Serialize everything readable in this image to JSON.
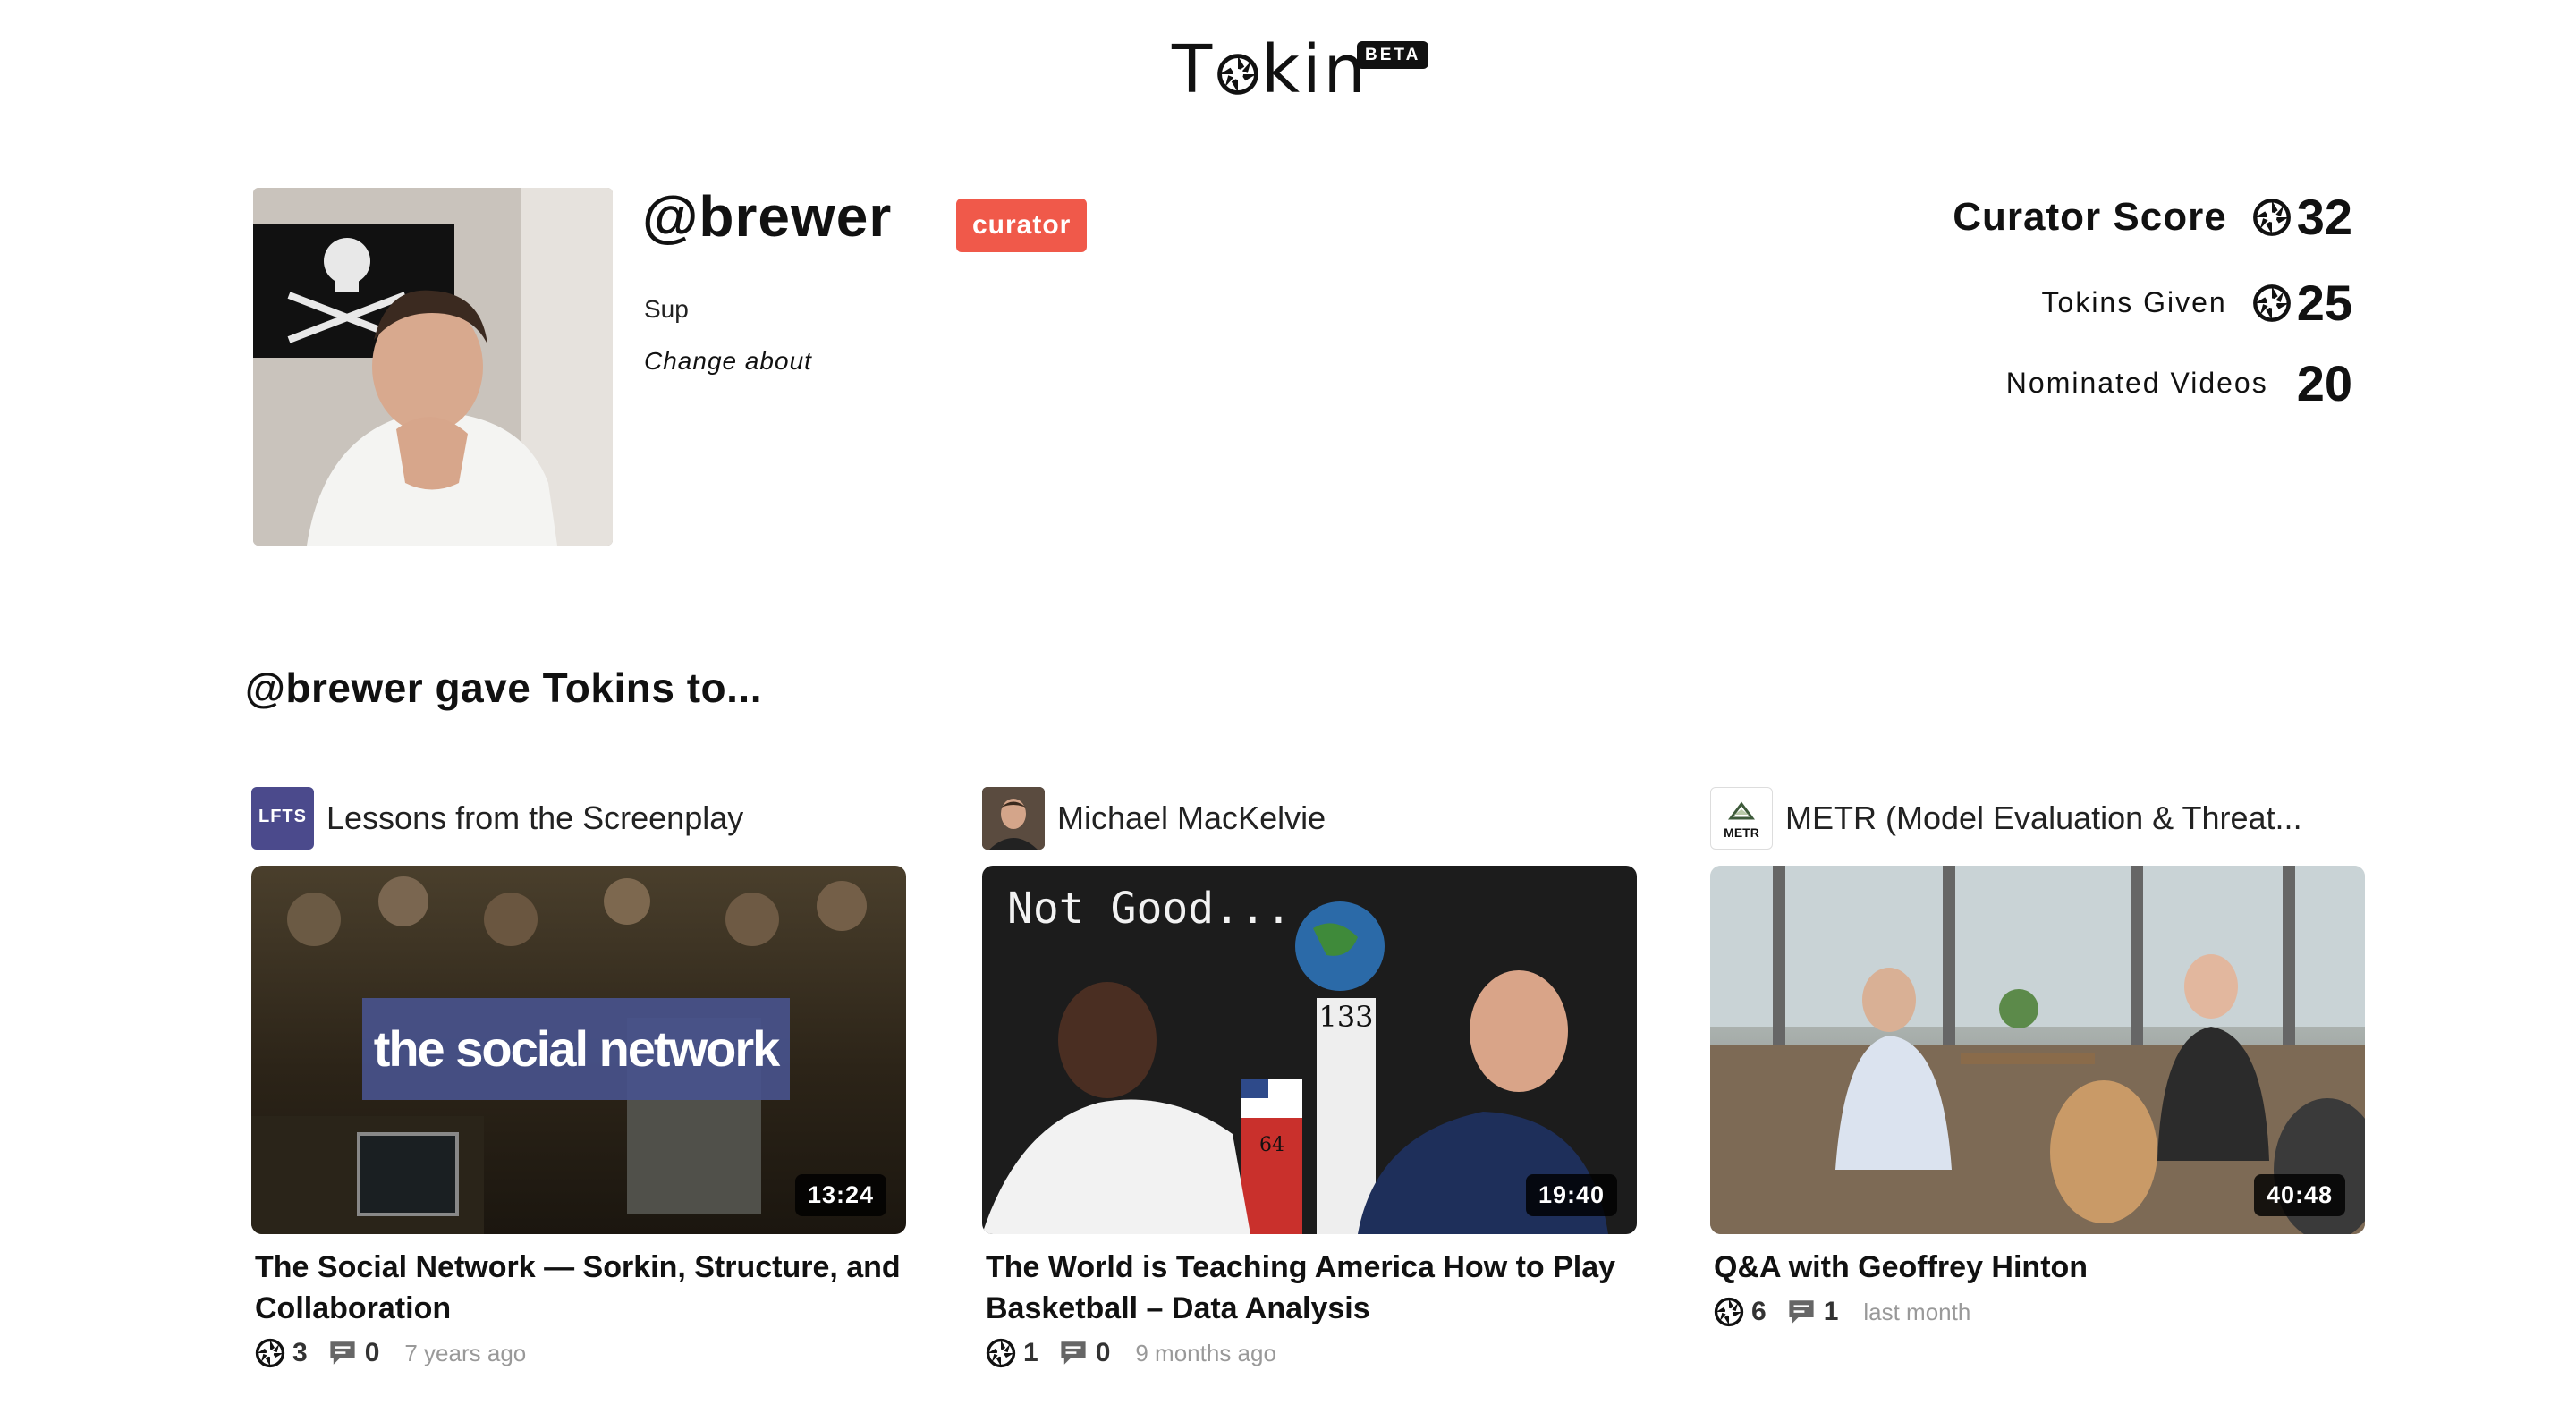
{
  "brand": {
    "name_prefix": "T",
    "name_suffix": "kin",
    "badge": "BETA"
  },
  "profile": {
    "username": "@brewer",
    "role": "curator",
    "about": "Sup",
    "change_about": "Change about"
  },
  "stats": {
    "curator_score": {
      "label": "Curator Score",
      "value": "32"
    },
    "tokins_given": {
      "label": "Tokins Given",
      "value": "25"
    },
    "nominated_videos": {
      "label": "Nominated Videos",
      "value": "20"
    }
  },
  "section": {
    "heading": "@brewer gave Tokins to..."
  },
  "videos": [
    {
      "channel": "Lessons from the Screenplay",
      "channel_icon_text": "LFTS",
      "thumb_text": "the social network",
      "duration": "13:24",
      "title": "The Social Network — Sorkin, Structure, and Collaboration",
      "tokins": "3",
      "comments": "0",
      "ago": "7 years ago"
    },
    {
      "channel": "Michael MacKelvie",
      "thumb_text": "Not Good...",
      "thumb_num_a": "133",
      "thumb_num_b": "64",
      "duration": "19:40",
      "title": "The World is Teaching America How to Play Basketball – Data Analysis",
      "tokins": "1",
      "comments": "0",
      "ago": "9 months ago"
    },
    {
      "channel": "METR (Model Evaluation & Threat...",
      "channel_icon_text": "METR",
      "duration": "40:48",
      "title": "Q&A with Geoffrey Hinton",
      "tokins": "6",
      "comments": "1",
      "ago": "last month"
    }
  ],
  "colors": {
    "badge": "#f0594a",
    "lfts": "#4b4a8c",
    "text": "#111111"
  },
  "icons": {
    "tokin": "tokin-icon",
    "comment": "comment-icon"
  }
}
